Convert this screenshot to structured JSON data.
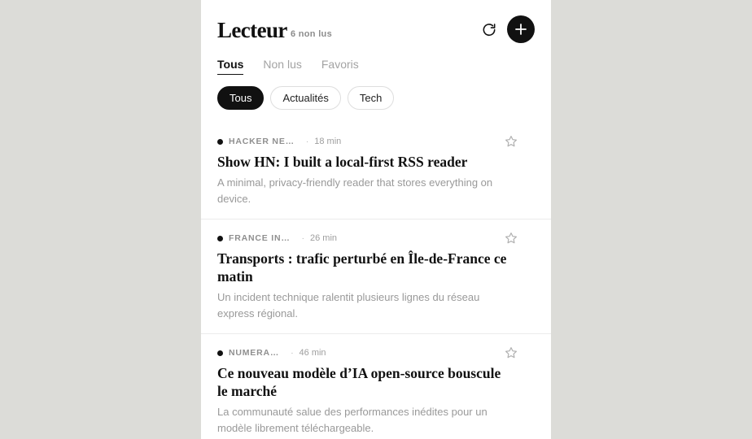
{
  "app": {
    "title": "Lecteur",
    "unread_label": "6 non lus"
  },
  "icons": {
    "refresh": "refresh-icon",
    "add": "plus-icon",
    "star": "star-outline-icon"
  },
  "tabs": [
    {
      "label": "Tous",
      "active": true
    },
    {
      "label": "Non lus",
      "active": false
    },
    {
      "label": "Favoris",
      "active": false
    }
  ],
  "chips": [
    {
      "label": "Tous",
      "active": true
    },
    {
      "label": "Actualités",
      "active": false
    },
    {
      "label": "Tech",
      "active": false
    }
  ],
  "articles": [
    {
      "source": "HACKER NE…",
      "time": "18 min",
      "unread": true,
      "starred": false,
      "title": "Show HN: I built a local-first RSS reader",
      "summary": "A minimal, privacy-friendly reader that stores everything on device."
    },
    {
      "source": "FRANCE IN…",
      "time": "26 min",
      "unread": true,
      "starred": false,
      "title": "Transports : trafic perturbé en Île-de-France ce matin",
      "summary": "Un incident technique ralentit plusieurs lignes du réseau express régional."
    },
    {
      "source": "NUMERA…",
      "time": "46 min",
      "unread": true,
      "starred": false,
      "title": "Ce nouveau modèle d’IA open-source bouscule le marché",
      "summary": "La communauté salue des performances inédites pour un modèle librement téléchargeable."
    }
  ],
  "colors": {
    "background": "#dcdcd8",
    "surface": "#ffffff",
    "accent": "#111111",
    "muted": "#999999"
  }
}
